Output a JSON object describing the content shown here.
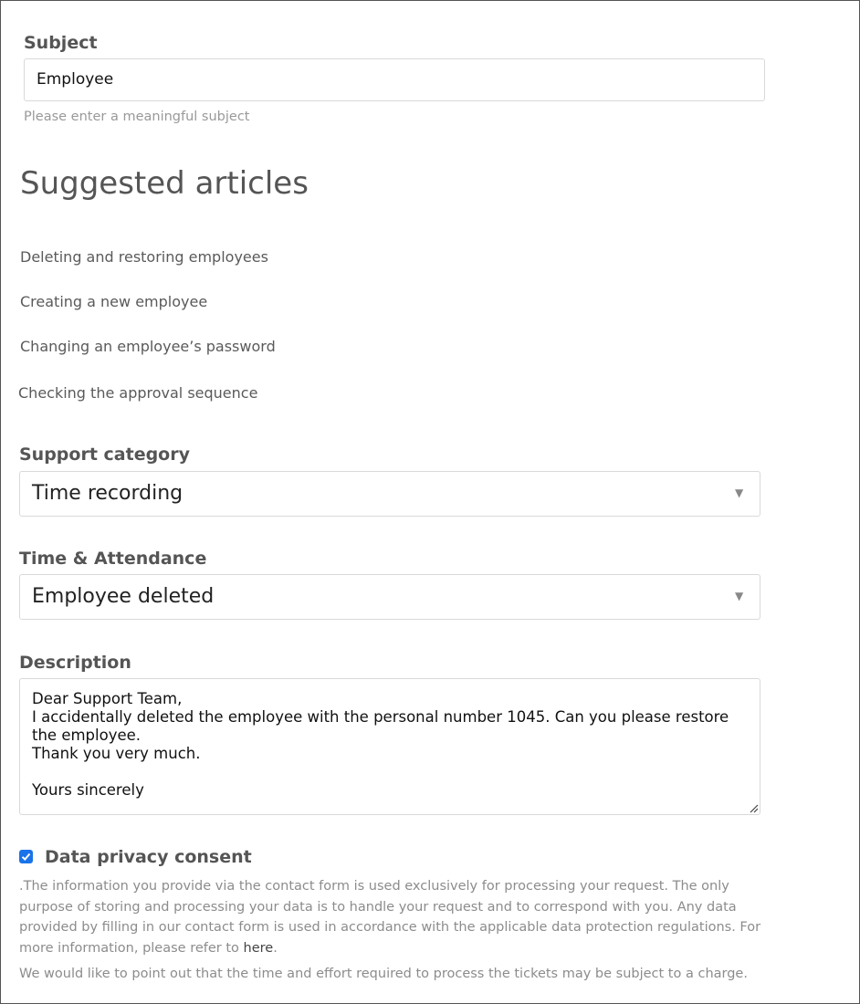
{
  "subject": {
    "label": "Subject",
    "value": "Employee",
    "hint": "Please enter a meaningful subject"
  },
  "suggested": {
    "heading": "Suggested articles",
    "articles": [
      "Deleting and restoring employees",
      "Creating a new employee",
      "Changing an employee’s password",
      "Checking the approval sequence"
    ]
  },
  "support_category": {
    "label": "Support category",
    "selected": "Time recording"
  },
  "time_attendance": {
    "label": "Time & Attendance",
    "selected": "Employee deleted"
  },
  "description": {
    "label": "Description",
    "value": "Dear Support Team,\nI accidentally deleted the employee with the personal number 1045. Can you please restore the employee.\nThank you very much.\n\nYours sincerely"
  },
  "privacy": {
    "label": "Data privacy consent",
    "checked": true,
    "text": ".The information you provide via the contact form is used exclusively for processing your request. The only purpose of storing and processing your data is to handle your request and to correspond with you. Any data provided by filling in our contact form is used in accordance with the applicable data protection regulations. For more information, please refer to ",
    "link": "here",
    "after_link": ".",
    "charge_notice": "We would like to point out that the time and effort required to process the tickets may be subject to a charge."
  },
  "colors": {
    "accent": "#1a73e8",
    "label": "#555555",
    "hint": "#999999"
  }
}
